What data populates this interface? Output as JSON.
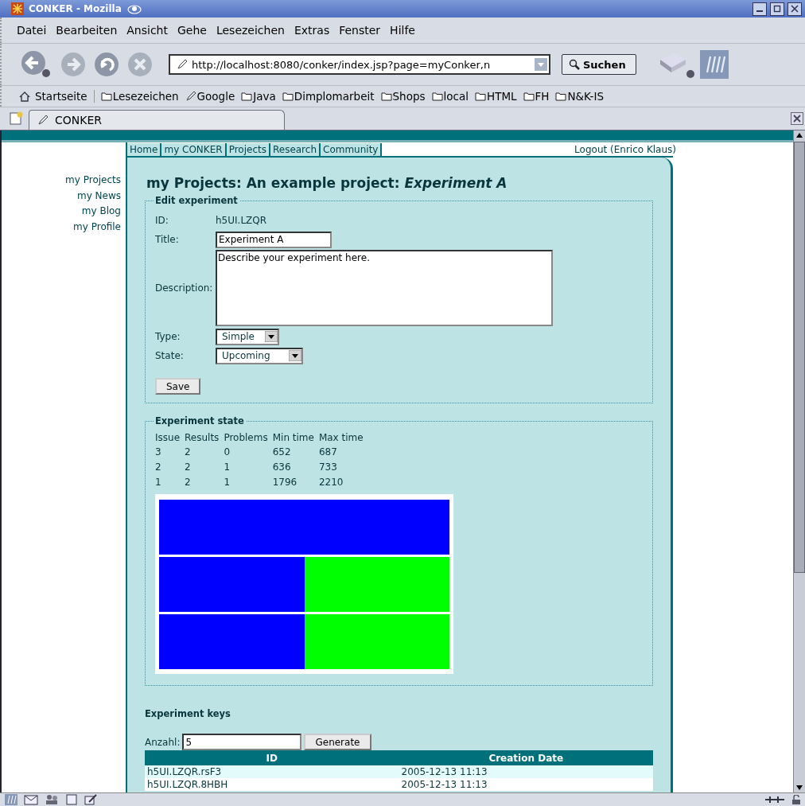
{
  "window": {
    "title": "CONKER - Mozilla"
  },
  "menu": [
    "Datei",
    "Bearbeiten",
    "Ansicht",
    "Gehe",
    "Lesezeichen",
    "Extras",
    "Fenster",
    "Hilfe"
  ],
  "toolbar": {
    "url": "http://localhost:8080/conker/index.jsp?page=myConker,n",
    "search_button": "Suchen"
  },
  "bookmarks": [
    {
      "label": "Startseite",
      "kind": "home"
    },
    {
      "label": "Lesezeichen",
      "kind": "folder"
    },
    {
      "label": "Google",
      "kind": "link"
    },
    {
      "label": "Java",
      "kind": "folder"
    },
    {
      "label": "Dimplomarbeit",
      "kind": "folder"
    },
    {
      "label": "Shops",
      "kind": "folder"
    },
    {
      "label": "local",
      "kind": "folder"
    },
    {
      "label": "HTML",
      "kind": "folder"
    },
    {
      "label": "FH",
      "kind": "folder"
    },
    {
      "label": "N&K-IS",
      "kind": "folder"
    }
  ],
  "tab": {
    "label": "CONKER"
  },
  "nav": [
    {
      "label": "Home"
    },
    {
      "label": "my CONKER"
    },
    {
      "label": "Projects"
    },
    {
      "label": "Research"
    },
    {
      "label": "Community"
    }
  ],
  "logout": "Logout (Enrico Klaus)",
  "sidebar": {
    "items": [
      "my Projects",
      "my News",
      "my Blog",
      "my Profile"
    ]
  },
  "heading": "my Projects: An example project: *Experiment A*",
  "edit": {
    "legend": "Edit experiment",
    "id_label": "ID:",
    "id_value": "h5UI.LZQR",
    "title_label": "Title:",
    "title_value": "Experiment A",
    "description_label": "Description:",
    "description_value": "Describe your experiment here.",
    "type_label": "Type:",
    "type_value": "Simple",
    "state_label": "State:",
    "state_value": "Upcoming",
    "save": "Save"
  },
  "state": {
    "legend": "Experiment state",
    "columns": [
      "Issue",
      "Results",
      "Problems",
      "Min time",
      "Max time"
    ],
    "rows": [
      [
        "3",
        "2",
        "0",
        "652",
        "687"
      ],
      [
        "2",
        "2",
        "1",
        "636",
        "733"
      ],
      [
        "1",
        "2",
        "1",
        "1796",
        "2210"
      ]
    ]
  },
  "keys": {
    "title": "Experiment keys",
    "count_label": "Anzahl:",
    "count_value": "5",
    "generate": "Generate",
    "columns": [
      "ID",
      "Creation Date"
    ],
    "rows": [
      [
        "h5UI.LZQR.rsF3",
        "2005-12-13 11:13"
      ],
      [
        "h5UI.LZQR.8HBH",
        "2005-12-13 11:13"
      ]
    ]
  }
}
